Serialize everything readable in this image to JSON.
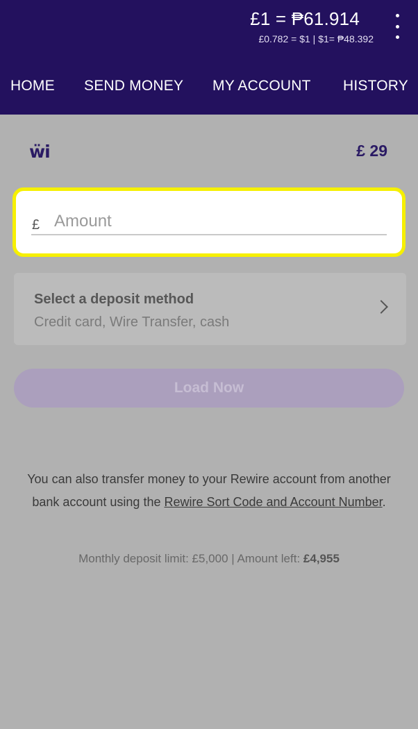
{
  "header": {
    "rate_main": "£1 = ₱61.914",
    "rate_sub": "£0.782 = $1  |  $1= ₱48.392",
    "menu_icon": "kebab-menu-icon"
  },
  "nav": {
    "items": [
      {
        "label": "HOME"
      },
      {
        "label": "SEND MONEY"
      },
      {
        "label": "MY ACCOUNT"
      },
      {
        "label": "HISTORY"
      }
    ]
  },
  "wallet": {
    "logo_text": "ẅi",
    "balance": "£ 29"
  },
  "amount": {
    "currency_symbol": "£",
    "placeholder": "Amount",
    "value": ""
  },
  "deposit": {
    "title": "Select a deposit method",
    "subtitle": "Credit card, Wire Transfer, cash",
    "chevron_icon": "chevron-right-icon"
  },
  "load_button": {
    "label": "Load Now"
  },
  "info": {
    "text_before": "You can also transfer money to your Rewire account from another bank account using the ",
    "link": "Rewire Sort Code and Account Number",
    "text_after": "."
  },
  "limit": {
    "text": "Monthly deposit limit: £5,000 | Amount left: ",
    "amount_left": "£4,955"
  },
  "colors": {
    "header_bg": "#23115e",
    "highlight": "#f6f000",
    "brand": "#2a1a64",
    "button_disabled": "#ab9fbd"
  }
}
